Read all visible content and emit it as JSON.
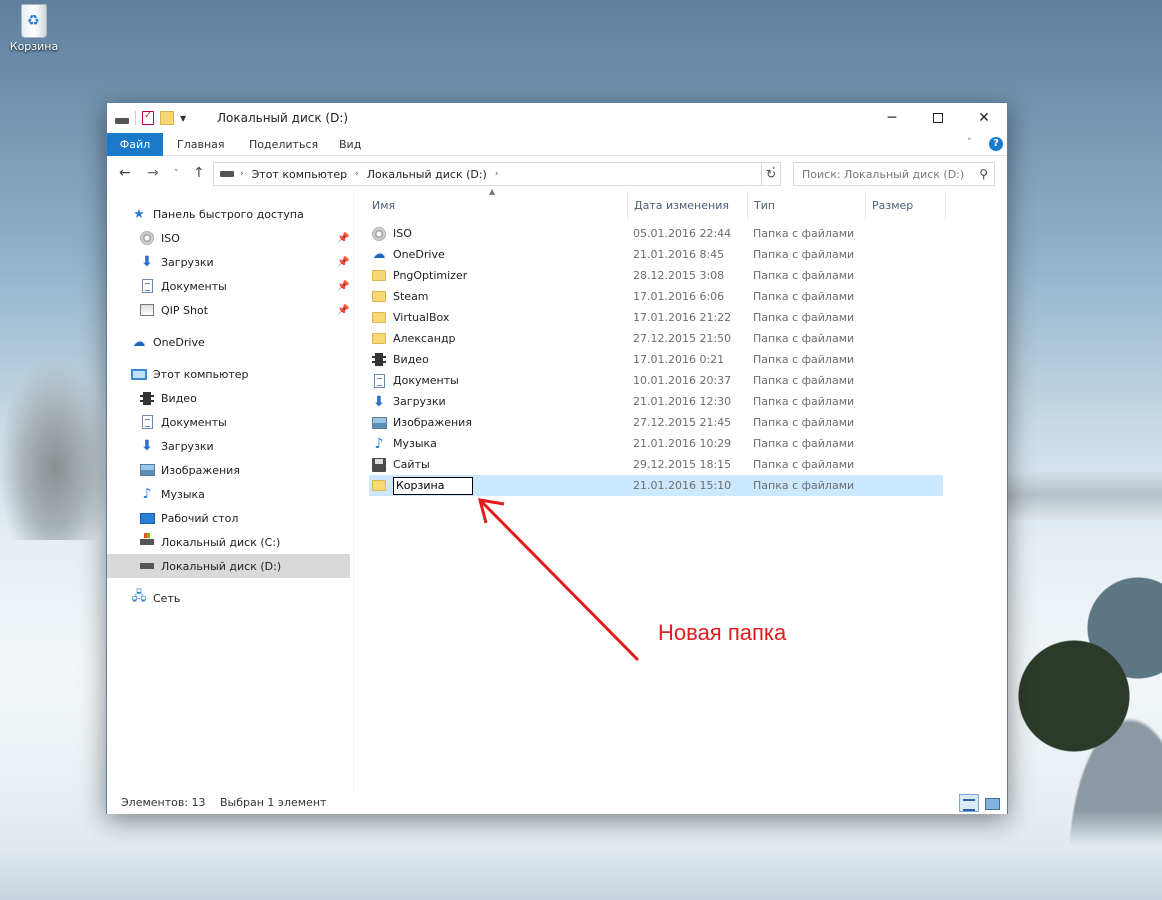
{
  "desktop": {
    "recycle_bin_label": "Корзина"
  },
  "window": {
    "title": "Локальный диск (D:)",
    "ribbon_tabs": [
      "Файл",
      "Главная",
      "Поделиться",
      "Вид"
    ],
    "address": {
      "crumbs": [
        "Этот компьютер",
        "Локальный диск (D:)"
      ]
    },
    "search_placeholder": "Поиск: Локальный диск (D:)"
  },
  "nav_pane": {
    "quick_access": "Панель быстрого доступа",
    "quick_items": [
      {
        "label": "ISO",
        "icon": "cd-icon"
      },
      {
        "label": "Загрузки",
        "icon": "downloads-icon"
      },
      {
        "label": "Документы",
        "icon": "documents-icon"
      },
      {
        "label": "QIP Shot",
        "icon": "qip-icon"
      }
    ],
    "onedrive": "OneDrive",
    "this_pc": "Этот компьютер",
    "pc_items": [
      {
        "label": "Видео",
        "icon": "video-icon"
      },
      {
        "label": "Документы",
        "icon": "documents-icon"
      },
      {
        "label": "Загрузки",
        "icon": "downloads-icon"
      },
      {
        "label": "Изображения",
        "icon": "pictures-icon"
      },
      {
        "label": "Музыка",
        "icon": "music-icon"
      },
      {
        "label": "Рабочий стол",
        "icon": "desktop-icon"
      },
      {
        "label": "Локальный диск (C:)",
        "icon": "drive-c-icon"
      },
      {
        "label": "Локальный диск (D:)",
        "icon": "drive-d-icon",
        "selected": true
      }
    ],
    "network": "Сеть"
  },
  "columns": {
    "name": "Имя",
    "date": "Дата изменения",
    "type": "Тип",
    "size": "Размер"
  },
  "files": [
    {
      "name": "ISO",
      "date": "05.01.2016 22:44",
      "type": "Папка с файлами",
      "icon": "cd-icon"
    },
    {
      "name": "OneDrive",
      "date": "21.01.2016 8:45",
      "type": "Папка с файлами",
      "icon": "cloud-icon"
    },
    {
      "name": "PngOptimizer",
      "date": "28.12.2015 3:08",
      "type": "Папка с файлами",
      "icon": "folder-icon"
    },
    {
      "name": "Steam",
      "date": "17.01.2016 6:06",
      "type": "Папка с файлами",
      "icon": "folder-icon"
    },
    {
      "name": "VirtualBox",
      "date": "17.01.2016 21:22",
      "type": "Папка с файлами",
      "icon": "folder-icon"
    },
    {
      "name": "Александр",
      "date": "27.12.2015 21:50",
      "type": "Папка с файлами",
      "icon": "folder-icon"
    },
    {
      "name": "Видео",
      "date": "17.01.2016 0:21",
      "type": "Папка с файлами",
      "icon": "video-icon"
    },
    {
      "name": "Документы",
      "date": "10.01.2016 20:37",
      "type": "Папка с файлами",
      "icon": "documents-icon"
    },
    {
      "name": "Загрузки",
      "date": "21.01.2016 12:30",
      "type": "Папка с файлами",
      "icon": "downloads-icon"
    },
    {
      "name": "Изображения",
      "date": "27.12.2015 21:45",
      "type": "Папка с файлами",
      "icon": "pictures-icon"
    },
    {
      "name": "Музыка",
      "date": "21.01.2016 10:29",
      "type": "Папка с файлами",
      "icon": "music-icon"
    },
    {
      "name": "Сайты",
      "date": "29.12.2015 18:15",
      "type": "Папка с файлами",
      "icon": "disk-icon"
    },
    {
      "name": "Корзина",
      "date": "21.01.2016 15:10",
      "type": "Папка с файлами",
      "icon": "folder-icon",
      "selected": true,
      "renaming": true
    }
  ],
  "status": {
    "count": "Элементов: 13",
    "selection": "Выбран 1 элемент"
  },
  "annotation": {
    "text": "Новая папка",
    "color": "#e21c1c"
  },
  "colors": {
    "accent": "#1979ca",
    "selection": "#cce8ff"
  }
}
